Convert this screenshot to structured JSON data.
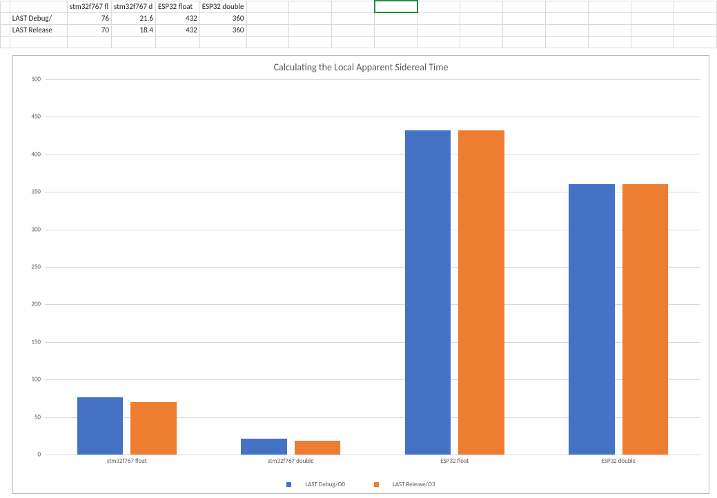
{
  "table": {
    "headers": [
      "",
      "stm32f767 fl",
      "stm32f767 d",
      "ESP32 float",
      "ESP32 double"
    ],
    "rows": [
      {
        "label": "LAST Debug/",
        "values": [
          "76",
          "21.6",
          "432",
          "360"
        ]
      },
      {
        "label": "LAST Release",
        "values": [
          "70",
          "18.4",
          "432",
          "360"
        ]
      }
    ]
  },
  "chart_data": {
    "type": "bar",
    "title": "Calculating the Local Apparent Sidereal Time",
    "xlabel": "",
    "ylabel": "",
    "ylim": [
      0,
      500
    ],
    "yticks": [
      0,
      50,
      100,
      150,
      200,
      250,
      300,
      350,
      400,
      450,
      500
    ],
    "categories": [
      "stm32f767 float",
      "stm32f767 double",
      "ESP32 float",
      "ESP32 double"
    ],
    "series": [
      {
        "name": "LAST Debug/O0",
        "color": "#4472C4",
        "values": [
          76,
          21.6,
          432,
          360
        ]
      },
      {
        "name": "LAST Release/O3",
        "color": "#ED7D31",
        "values": [
          70,
          18.4,
          432,
          360
        ]
      }
    ],
    "legend_position": "bottom"
  }
}
